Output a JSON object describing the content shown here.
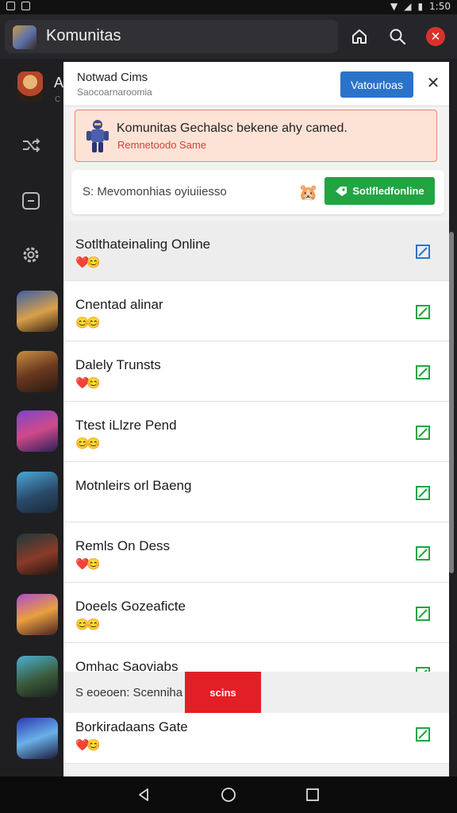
{
  "app": {
    "title": "Komunitas"
  },
  "status_bar": {
    "time": "1:50"
  },
  "colors": {
    "accent_blue": "#2b73c8",
    "accent_green": "#22a443",
    "accent_red": "#e21f26",
    "alert_bg": "#fde2d6"
  },
  "sidebar": {
    "header_fragment": "A",
    "header_sub": "C",
    "icons": [
      "shuffle-icon",
      "square-icon",
      "settings-icon"
    ]
  },
  "notification_card": {
    "title": "Notwad Cims",
    "subtitle": "Saocoarnaroomia",
    "action_label": "Vatourloas"
  },
  "alert": {
    "title": "Komunitas Gechalsc bekene ahy camed.",
    "subtitle": "Remnetoodo Same"
  },
  "search_card": {
    "label": "S: Mevomonhias oyiuiiesso",
    "button_label": "Sotlfledfonline"
  },
  "games": [
    {
      "title": "Sotlthateinaling Online",
      "badges": "❤️😊",
      "highlight": true,
      "check_color": "#2b73c8"
    },
    {
      "title": "Cnentad alinar",
      "badges": "😊😊",
      "highlight": false,
      "check_color": "#22a443"
    },
    {
      "title": "Dalely Trunsts",
      "badges": "❤️😊",
      "highlight": false,
      "check_color": "#22a443"
    },
    {
      "title": "Ttest iLlzre Pend",
      "badges": "😊😊",
      "highlight": false,
      "check_color": "#22a443"
    },
    {
      "title": "Motnleirs orl Baeng",
      "badges": "",
      "highlight": false,
      "check_color": "#22a443"
    },
    {
      "title": "Remls On Dess",
      "badges": "❤️😊",
      "highlight": false,
      "check_color": "#22a443"
    },
    {
      "title": "Doeels Gozeaficte",
      "badges": "😊😊",
      "highlight": false,
      "check_color": "#22a443"
    },
    {
      "title": "Omhac Saoviabs",
      "badges": "",
      "highlight": false,
      "check_color": "#22a443"
    },
    {
      "title": "Borkiradaans Gate",
      "badges": "❤️😊",
      "highlight": false,
      "check_color": "#22a443"
    }
  ],
  "overlay": {
    "label": "S eoeoen: Scenniha",
    "button_label": "scins"
  }
}
